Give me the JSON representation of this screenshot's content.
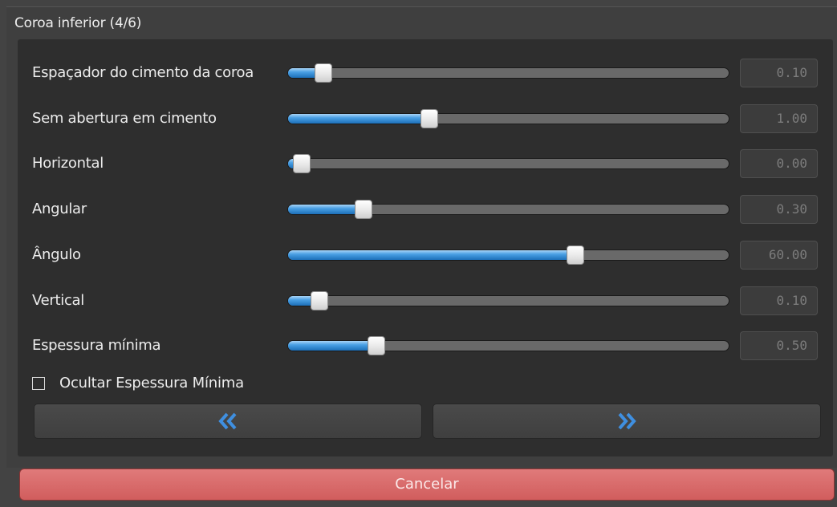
{
  "group": {
    "title": "Coroa inferior (4/6)"
  },
  "sliders": [
    {
      "label": "Espaçador do cimento da coroa",
      "value": "0.10",
      "fill_fraction": 0.08
    },
    {
      "label": "Sem abertura em cimento",
      "value": "1.00",
      "fill_fraction": 0.32
    },
    {
      "label": "Horizontal",
      "value": "0.00",
      "fill_fraction": 0.03
    },
    {
      "label": "Angular",
      "value": "0.30",
      "fill_fraction": 0.17
    },
    {
      "label": "Ângulo",
      "value": "60.00",
      "fill_fraction": 0.65
    },
    {
      "label": "Vertical",
      "value": "0.10",
      "fill_fraction": 0.07
    },
    {
      "label": "Espessura mínima",
      "value": "0.50",
      "fill_fraction": 0.2
    }
  ],
  "checkbox": {
    "label": "Ocultar Espessura Mínima",
    "checked": false
  },
  "nav": {
    "prev_icon": "double-chevron-left-icon",
    "next_icon": "double-chevron-right-icon"
  },
  "cancel": {
    "label": "Cancelar"
  },
  "colors": {
    "accent_blue": "#2d82cf",
    "cancel_red": "#d86a6a",
    "panel_dark": "#2e2e2e"
  }
}
